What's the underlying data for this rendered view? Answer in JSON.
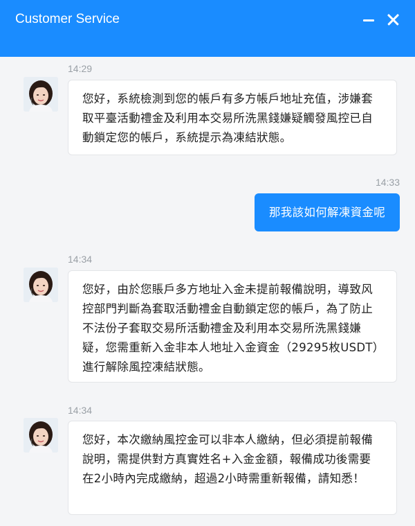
{
  "header": {
    "title": "Customer Service"
  },
  "messages": [
    {
      "time": "14:29",
      "direction": "incoming",
      "text": "您好，系統檢測到您的帳戶有多方帳戶地址充值，涉嫌套取平臺活動禮金及利用本交易所洗黑錢嫌疑觸發風控已自動鎖定您的帳戶，系統提示為凍結狀態。"
    },
    {
      "time": "14:33",
      "direction": "outgoing",
      "text": "那我該如何解凍資金呢"
    },
    {
      "time": "14:34",
      "direction": "incoming",
      "text": "您好，由於您賬戶多方地址入金未提前報備說明，導致风控部門判斷為套取活動禮金自動鎖定您的帳戶，為了防止不法份子套取交易所活動禮金及利用本交易所洗黑錢嫌疑，您需重新入金非本人地址入金資金（29295枚USDT）進行解除風控凍結狀態。"
    },
    {
      "time": "14:34",
      "direction": "incoming",
      "text": "您好，本次繳納風控金可以非本人繳納，但必須提前報備說明，需提供對方真實姓名+入金金額，報備成功後需要在2小時內完成繳納，超過2小時需重新報備，請知悉！"
    }
  ],
  "colors": {
    "header": "#1a8cff",
    "outgoing_bubble": "#1a8cff",
    "background": "#f4f5f7"
  }
}
